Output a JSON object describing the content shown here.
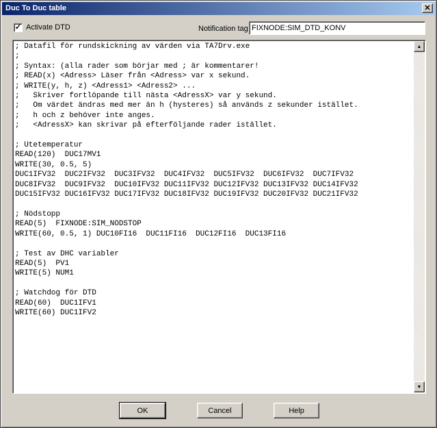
{
  "window": {
    "title": "Duc To Duc table",
    "close_glyph": "✕"
  },
  "options": {
    "activate_checked_glyph": "✓",
    "activate_label": "Activate DTD",
    "notification_label": "Notification tag",
    "notification_value": "FIXNODE:SIM_DTD_KONV"
  },
  "editor": {
    "lines": [
      "; Datafil för rundskickning av värden via TA7Drv.exe",
      ";",
      "; Syntax: (alla rader som börjar med ; är kommentarer!",
      "; READ(x) <Adress> Läser från <Adress> var x sekund.",
      "; WRITE(y, h, z) <Adress1> <Adress2> ...",
      ";   Skriver fortlöpande till nästa <AdressX> var y sekund.",
      ";   Om värdet ändras med mer än h (hysteres) så används z sekunder istället.",
      ";   h och z behöver inte anges.",
      ";   <AdressX> kan skrivar på efterföljande rader istället.",
      "",
      "; Utetemperatur",
      "READ(120)  DUC17MV1",
      "WRITE(30, 0.5, 5)",
      "DUC1IFV32  DUC2IFV32  DUC3IFV32  DUC4IFV32  DUC5IFV32  DUC6IFV32  DUC7IFV32",
      "DUC8IFV32  DUC9IFV32  DUC10IFV32 DUC11IFV32 DUC12IFV32 DUC13IFV32 DUC14IFV32",
      "DUC15IFV32 DUC16IFV32 DUC17IFV32 DUC18IFV32 DUC19IFV32 DUC20IFV32 DUC21IFV32",
      "",
      "; Nödstopp",
      "READ(5)  FIXNODE:SIM_NODSTOP",
      "WRITE(60, 0.5, 1) DUC10FI16  DUC11FI16  DUC12FI16  DUC13FI16",
      "",
      "; Test av DHC variabler",
      "READ(5)  PV1",
      "WRITE(5) NUM1",
      "",
      "; Watchdog för DTD",
      "READ(60)  DUC1IFV1",
      "WRITE(60) DUC1IFV2"
    ],
    "scroll_up_glyph": "▲",
    "scroll_down_glyph": "▼"
  },
  "buttons": {
    "ok": "OK",
    "cancel": "Cancel",
    "help": "Help"
  }
}
